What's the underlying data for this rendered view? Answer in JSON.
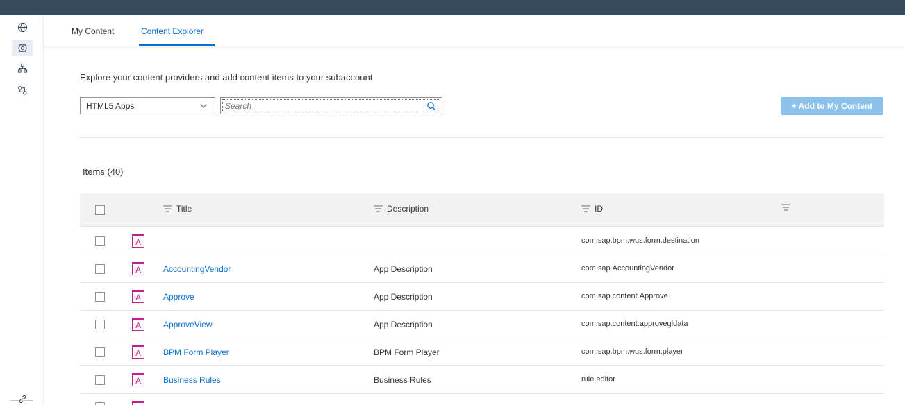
{
  "tabs": [
    {
      "label": "My Content",
      "active": false
    },
    {
      "label": "Content Explorer",
      "active": true
    }
  ],
  "intro_text": "Explore your content providers and add content items to your subaccount",
  "filter": {
    "selected": "HTML5 Apps"
  },
  "search": {
    "placeholder": "Search",
    "value": ""
  },
  "add_button": {
    "label": "+ Add to My Content"
  },
  "items_count": "Items (40)",
  "table": {
    "columns": [
      "Title",
      "Description",
      "ID",
      ""
    ],
    "rows": [
      {
        "icon": "A",
        "title": "",
        "description": "",
        "id": "com.sap.bpm.wus.form.destination"
      },
      {
        "icon": "A",
        "title": "AccountingVendor",
        "description": "App Description",
        "id": "com.sap.AccountingVendor"
      },
      {
        "icon": "A",
        "title": "Approve",
        "description": "App Description",
        "id": "com.sap.content.Approve"
      },
      {
        "icon": "A",
        "title": "ApproveView",
        "description": "App Description",
        "id": "com.sap.content.approvegldata"
      },
      {
        "icon": "A",
        "title": "BPM Form Player",
        "description": "BPM Form Player",
        "id": "com.sap.bpm.wus.form.player"
      },
      {
        "icon": "A",
        "title": "Business Rules",
        "description": "Business Rules",
        "id": "rule.editor"
      }
    ]
  },
  "colors": {
    "accent": "#0a6ed1",
    "topbar": "#354a5f",
    "app_icon": "#c2208e",
    "button_disabled": "#8cc1ec"
  },
  "icons": [
    "globe-icon",
    "content-icon",
    "hierarchy-icon",
    "connection-icon",
    "link-icon",
    "chevron-down-icon",
    "search-icon",
    "filter-icon",
    "checkbox-icon",
    "app-icon"
  ]
}
